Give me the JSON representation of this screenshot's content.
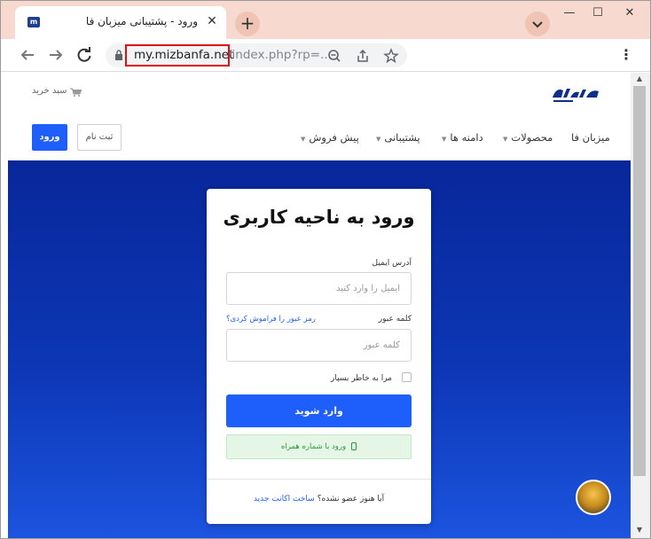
{
  "browser": {
    "tab_title": "ورود - پشتیبانی میزبان فا",
    "tab_close": "✕",
    "new_tab": "+",
    "url_host": "my.mizbanfa.net",
    "url_path": "/index.php?rp=...",
    "menu": "⋮",
    "win_min": "—",
    "win_max": "☐",
    "win_close": "✕"
  },
  "site": {
    "cart_label": "سبد خرید",
    "nav_items": [
      "میزبان فا",
      "محصولات",
      "دامنه ها",
      "پشتیبانی",
      "پیش فروش"
    ],
    "register_button": "ثبت نام",
    "login_button": "ورود"
  },
  "login_card": {
    "title": "ورود به ناحیه کاربری",
    "email_label": "آدرس ایمیل",
    "email_placeholder": "ایمیل را وارد کنید",
    "password_label": "کلمه عبور",
    "forgot_password": "رمز عبور را فراموش کردی؟",
    "password_placeholder": "کلمه عبور",
    "remember_me": "مرا به خاطر بسپار",
    "submit_button": "وارد شوید",
    "mobile_login": "ورود با شماره همراه",
    "signup_question": "آیا هنوز عضو نشده؟",
    "signup_link": "ساخت اکانت جدید"
  },
  "colors": {
    "accent": "#1e5efb",
    "hero_top": "#08279a",
    "hero_bottom": "#1c55e0",
    "tab_strip": "#f7d9cf",
    "url_highlight": "#e01010"
  }
}
